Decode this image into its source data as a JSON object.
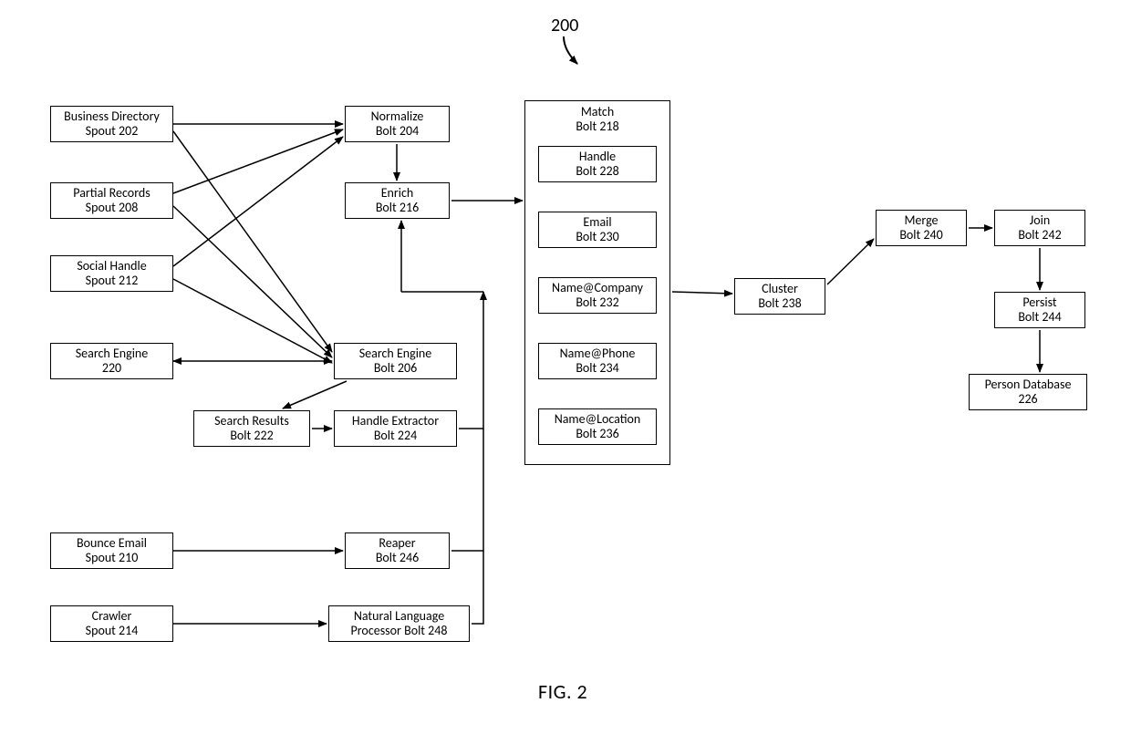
{
  "ref_number": "200",
  "figure_label": "FIG. 2",
  "boxes": {
    "business_directory": {
      "l1": "Business Directory",
      "l2": "Spout 202"
    },
    "partial_records": {
      "l1": "Partial Records",
      "l2": "Spout 208"
    },
    "social_handle": {
      "l1": "Social Handle",
      "l2": "Spout 212"
    },
    "search_engine": {
      "l1": "Search Engine",
      "l2": "220"
    },
    "bounce_email": {
      "l1": "Bounce Email",
      "l2": "Spout 210"
    },
    "crawler": {
      "l1": "Crawler",
      "l2": "Spout 214"
    },
    "normalize": {
      "l1": "Normalize",
      "l2": "Bolt 204"
    },
    "enrich": {
      "l1": "Enrich",
      "l2": "Bolt 216"
    },
    "search_engine_bolt": {
      "l1": "Search Engine",
      "l2": "Bolt 206"
    },
    "search_results": {
      "l1": "Search Results",
      "l2": "Bolt 222"
    },
    "handle_extractor": {
      "l1": "Handle Extractor",
      "l2": "Bolt 224"
    },
    "reaper": {
      "l1": "Reaper",
      "l2": "Bolt 246"
    },
    "nlp": {
      "l1": "Natural Language",
      "l2": "Processor Bolt 248"
    },
    "match_header": {
      "l1": "Match",
      "l2": "Bolt 218"
    },
    "match_handle": {
      "l1": "Handle",
      "l2": "Bolt 228"
    },
    "match_email": {
      "l1": "Email",
      "l2": "Bolt 230"
    },
    "match_company": {
      "l1": "Name@Company",
      "l2": "Bolt 232"
    },
    "match_phone": {
      "l1": "Name@Phone",
      "l2": "Bolt 234"
    },
    "match_location": {
      "l1": "Name@Location",
      "l2": "Bolt 236"
    },
    "cluster": {
      "l1": "Cluster",
      "l2": "Bolt 238"
    },
    "merge": {
      "l1": "Merge",
      "l2": "Bolt 240"
    },
    "join": {
      "l1": "Join",
      "l2": "Bolt 242"
    },
    "persist": {
      "l1": "Persist",
      "l2": "Bolt 244"
    },
    "person_db": {
      "l1": "Person Database",
      "l2": "226"
    }
  }
}
